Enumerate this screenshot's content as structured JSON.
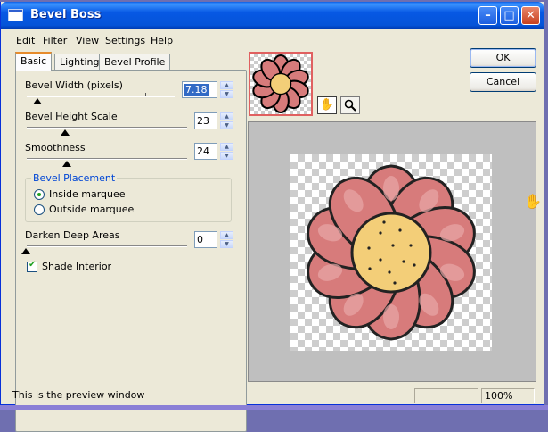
{
  "window": {
    "title": "Bevel Boss",
    "min_glyph": "–",
    "max_glyph": "□",
    "close_glyph": "✕"
  },
  "menu": [
    "Edit",
    "Filter",
    "View",
    "Settings",
    "Help"
  ],
  "tabs": [
    {
      "label": "Basic",
      "active": true
    },
    {
      "label": "Lighting",
      "active": false
    },
    {
      "label": "Bevel Profile",
      "active": false
    }
  ],
  "basic": {
    "bevel_width": {
      "label": "Bevel Width (pixels)",
      "value": "7.18",
      "level": 0.06
    },
    "bevel_height": {
      "label": "Bevel Height Scale",
      "value": "23",
      "level": 0.23
    },
    "smoothness": {
      "label": "Smoothness",
      "value": "24",
      "level": 0.24
    },
    "placement": {
      "title": "Bevel Placement",
      "inside_label": "Inside marquee",
      "inside_selected": true,
      "outside_label": "Outside marquee",
      "outside_selected": false
    },
    "darken": {
      "label": "Darken Deep Areas",
      "value": "0",
      "level": 0.0
    },
    "shade_interior": {
      "label": "Shade Interior",
      "checked": true
    }
  },
  "buttons": {
    "ok": "OK",
    "cancel": "Cancel"
  },
  "status": {
    "message": "This is the preview window",
    "zoom": "100%"
  },
  "icons": {
    "hand": "hand-pan-icon",
    "zoom": "magnifier-icon"
  },
  "colors": {
    "petal": "#d77b7b",
    "center": "#f3ce78",
    "title_bar": "#0554d8"
  }
}
